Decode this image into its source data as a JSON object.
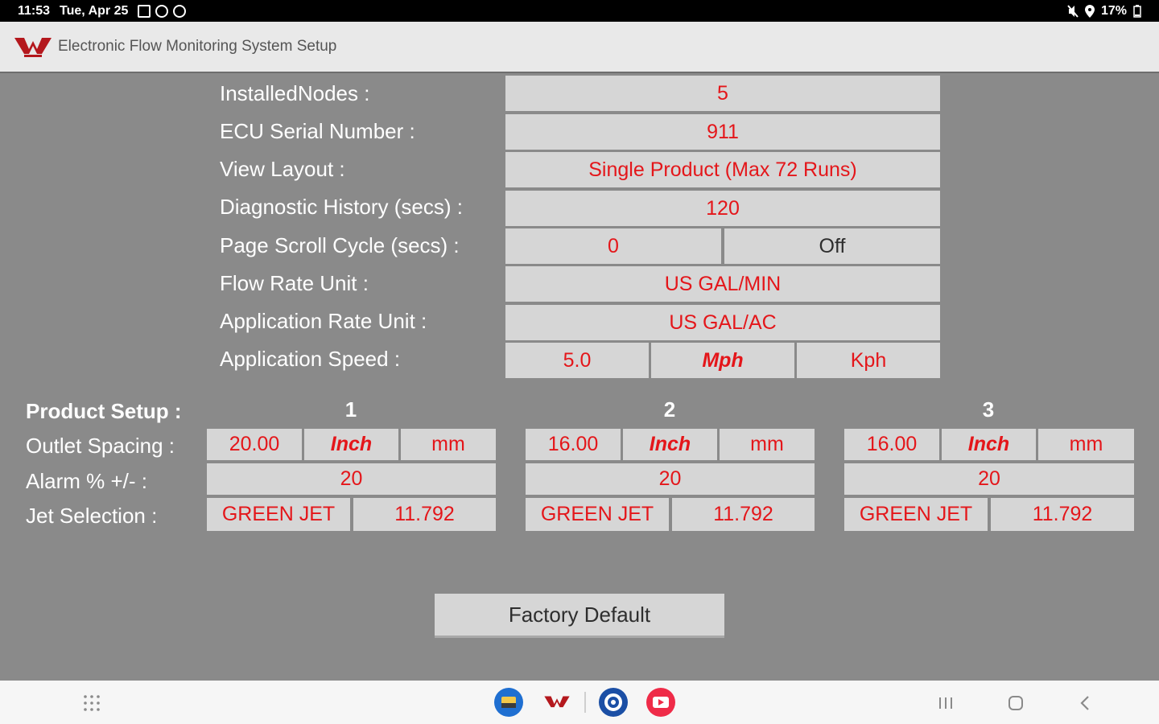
{
  "status_bar": {
    "time": "11:53",
    "date": "Tue, Apr 25",
    "battery": "17%"
  },
  "app": {
    "title": "Electronic Flow Monitoring System Setup",
    "brand_color": "#b4181d"
  },
  "settings": {
    "installed_nodes": {
      "label": "InstalledNodes :",
      "value": "5"
    },
    "ecu_serial": {
      "label": "ECU Serial Number :",
      "value": "911"
    },
    "view_layout": {
      "label": "View Layout :",
      "value": "Single Product (Max 72 Runs)"
    },
    "diagnostic_history": {
      "label": "Diagnostic History (secs) :",
      "value": "120"
    },
    "page_scroll": {
      "label": "Page Scroll Cycle (secs) :",
      "value": "0",
      "toggle": "Off"
    },
    "flow_rate_unit": {
      "label": "Flow Rate Unit :",
      "value": "US GAL/MIN"
    },
    "app_rate_unit": {
      "label": "Application Rate Unit :",
      "value": "US GAL/AC"
    },
    "app_speed": {
      "label": "Application Speed :",
      "value": "5.0",
      "unit_selected": "Mph",
      "unit_alt": "Kph"
    }
  },
  "product_setup": {
    "title": "Product Setup :",
    "row_labels": {
      "outlet_spacing": "Outlet Spacing :",
      "alarm": "Alarm % +/- :",
      "jet_selection": "Jet Selection :"
    },
    "products": [
      {
        "number": "1",
        "spacing": "20.00",
        "unit_selected": "Inch",
        "unit_alt": "mm",
        "alarm": "20",
        "jet": "GREEN JET",
        "jet_value": "11.792"
      },
      {
        "number": "2",
        "spacing": "16.00",
        "unit_selected": "Inch",
        "unit_alt": "mm",
        "alarm": "20",
        "jet": "GREEN JET",
        "jet_value": "11.792"
      },
      {
        "number": "3",
        "spacing": "16.00",
        "unit_selected": "Inch",
        "unit_alt": "mm",
        "alarm": "20",
        "jet": "GREEN JET",
        "jet_value": "11.792"
      }
    ]
  },
  "factory_default_label": "Factory Default",
  "colors": {
    "value_text": "#e4161a",
    "background": "#8a8a8a",
    "cell": "#d6d6d6"
  }
}
